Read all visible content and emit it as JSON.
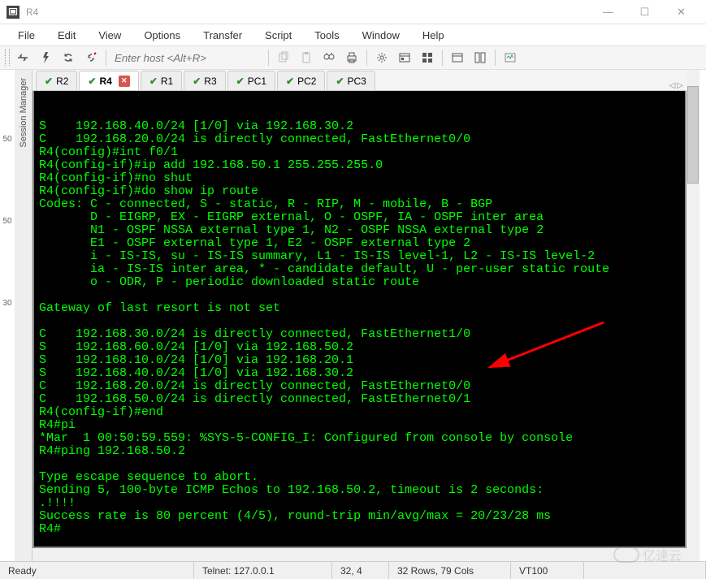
{
  "window": {
    "title": "R4",
    "minimize": "—",
    "maximize": "☐",
    "close": "✕"
  },
  "menu": {
    "file": "File",
    "edit": "Edit",
    "view": "View",
    "options": "Options",
    "transfer": "Transfer",
    "script": "Script",
    "tools": "Tools",
    "window": "Window",
    "help": "Help"
  },
  "toolbar": {
    "host_placeholder": "Enter host <Alt+R>"
  },
  "sidebar": {
    "label": "Session Manager"
  },
  "gutter": {
    "a": "50",
    "b": "50",
    "c": "30"
  },
  "tabs": [
    {
      "label": "R2",
      "active": false,
      "closable": false
    },
    {
      "label": "R4",
      "active": true,
      "closable": true
    },
    {
      "label": "R1",
      "active": false,
      "closable": false
    },
    {
      "label": "R3",
      "active": false,
      "closable": false
    },
    {
      "label": "PC1",
      "active": false,
      "closable": false
    },
    {
      "label": "PC2",
      "active": false,
      "closable": false
    },
    {
      "label": "PC3",
      "active": false,
      "closable": false
    }
  ],
  "tab_nav": {
    "left": "◁",
    "right": "▷"
  },
  "terminal": {
    "lines": [
      "S    192.168.40.0/24 [1/0] via 192.168.30.2",
      "C    192.168.20.0/24 is directly connected, FastEthernet0/0",
      "R4(config)#int f0/1",
      "R4(config-if)#ip add 192.168.50.1 255.255.255.0",
      "R4(config-if)#no shut",
      "R4(config-if)#do show ip route",
      "Codes: C - connected, S - static, R - RIP, M - mobile, B - BGP",
      "       D - EIGRP, EX - EIGRP external, O - OSPF, IA - OSPF inter area",
      "       N1 - OSPF NSSA external type 1, N2 - OSPF NSSA external type 2",
      "       E1 - OSPF external type 1, E2 - OSPF external type 2",
      "       i - IS-IS, su - IS-IS summary, L1 - IS-IS level-1, L2 - IS-IS level-2",
      "       ia - IS-IS inter area, * - candidate default, U - per-user static route",
      "       o - ODR, P - periodic downloaded static route",
      "",
      "Gateway of last resort is not set",
      "",
      "C    192.168.30.0/24 is directly connected, FastEthernet1/0",
      "S    192.168.60.0/24 [1/0] via 192.168.50.2",
      "S    192.168.10.0/24 [1/0] via 192.168.20.1",
      "S    192.168.40.0/24 [1/0] via 192.168.30.2",
      "C    192.168.20.0/24 is directly connected, FastEthernet0/0",
      "C    192.168.50.0/24 is directly connected, FastEthernet0/1",
      "R4(config-if)#end",
      "R4#pi",
      "*Mar  1 00:50:59.559: %SYS-5-CONFIG_I: Configured from console by console",
      "R4#ping 192.168.50.2",
      "",
      "Type escape sequence to abort.",
      "Sending 5, 100-byte ICMP Echos to 192.168.50.2, timeout is 2 seconds:",
      ".!!!!",
      "Success rate is 80 percent (4/5), round-trip min/avg/max = 20/23/28 ms",
      "R4#"
    ]
  },
  "status": {
    "ready": "Ready",
    "conn": "Telnet: 127.0.0.1",
    "pos": "32,  4",
    "size": "32 Rows, 79 Cols",
    "emul": "VT100"
  },
  "watermark": "亿速云"
}
